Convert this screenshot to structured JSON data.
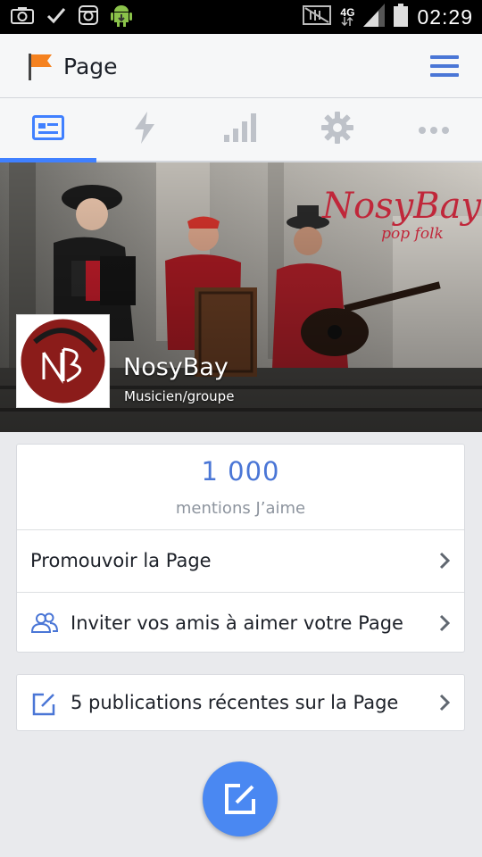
{
  "status_bar": {
    "network": "4G",
    "time": "02:29"
  },
  "header": {
    "title": "Page"
  },
  "tabs": [
    {
      "icon": "page-card-icon",
      "active": true
    },
    {
      "icon": "lightning-icon",
      "active": false
    },
    {
      "icon": "bar-chart-icon",
      "active": false
    },
    {
      "icon": "gear-icon",
      "active": false
    },
    {
      "icon": "more-dots-icon",
      "active": false
    }
  ],
  "cover": {
    "watermark_brand": "NosyBay",
    "watermark_tagline": "pop folk",
    "page_name": "NosyBay",
    "category": "Musicien/groupe"
  },
  "likes": {
    "count": "1 000",
    "label": "mentions J’aime"
  },
  "actions": {
    "promote": "Promouvoir la Page",
    "invite": "Inviter vos amis à aimer votre Page"
  },
  "posts": {
    "label": "5 publications récentes sur la Page"
  },
  "colors": {
    "accent": "#4080ff",
    "link_blue": "#4a76d6",
    "fab": "#4a88f2"
  }
}
